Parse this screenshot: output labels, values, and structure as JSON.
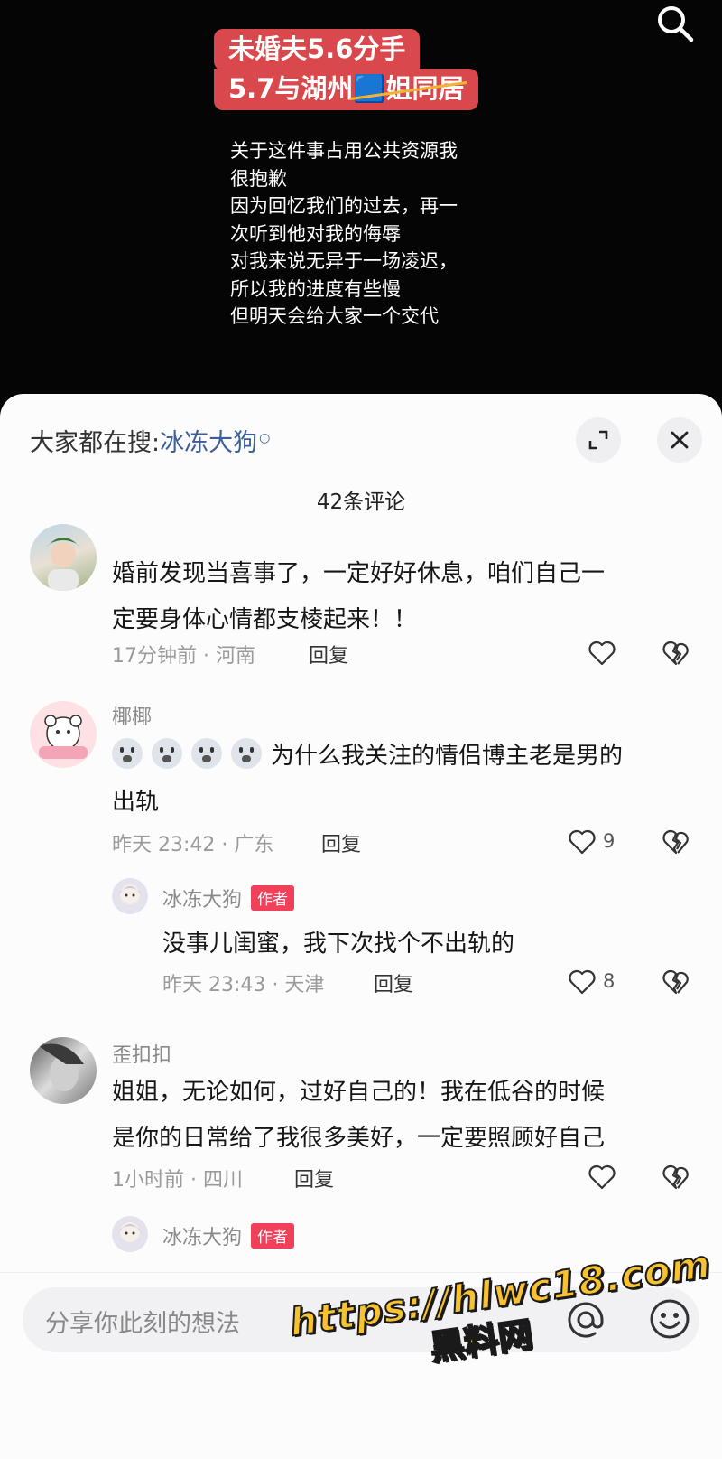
{
  "video": {
    "title_line1": "未婚夫5.6分手",
    "title_line2_prefix": "5.7与湖州",
    "title_line2_struck": "🟦姐同居",
    "caption": "关于这件事占用公共资源我\n很抱歉\n因为回忆我们的过去，再一\n次听到他对我的侮辱\n对我来说无异于一场凌迟，\n所以我的进度有些慢\n但明天会给大家一个交代"
  },
  "sheet": {
    "trending_prefix": "大家都在搜:",
    "trending_keyword": "冰冻大狗",
    "comment_count": "42条评论"
  },
  "comments": [
    {
      "user": "",
      "text_line1": "婚前发现当喜事了，一定好好休息，咱们自己一",
      "text_line2": "定要身体心情都支棱起来！！",
      "time_loc": "17分钟前 · 河南",
      "reply": "回复"
    },
    {
      "user": "椰椰",
      "text_line1": "为什么我关注的情侣博主老是男的",
      "text_line2": "出轨",
      "time_loc": "昨天 23:42 · 广东",
      "reply": "回复",
      "likes": "9",
      "sub": {
        "user": "冰冻大狗",
        "tag": "作者",
        "text": "没事儿闺蜜，我下次找个不出轨的",
        "time_loc": "昨天 23:43 · 天津",
        "reply": "回复",
        "likes": "8"
      }
    },
    {
      "user": "歪扣扣",
      "text_line1": "姐姐，无论如何，过好自己的！我在低谷的时候",
      "text_line2": "是你的日常给了我很多美好，一定要照顾好自己",
      "time_loc": "1小时前 · 四川",
      "reply": "回复",
      "sub": {
        "user": "冰冻大狗",
        "tag": "作者"
      }
    }
  ],
  "input": {
    "placeholder": "分享你此刻的想法"
  },
  "watermark": {
    "url": "https://hlwc18.com",
    "name": "黑料网"
  },
  "colors": {
    "title_red": "#d9484c",
    "keyword_blue": "#3c5f99",
    "author_tag": "#f0405a",
    "watermark_yellow": "#f7c12f"
  }
}
